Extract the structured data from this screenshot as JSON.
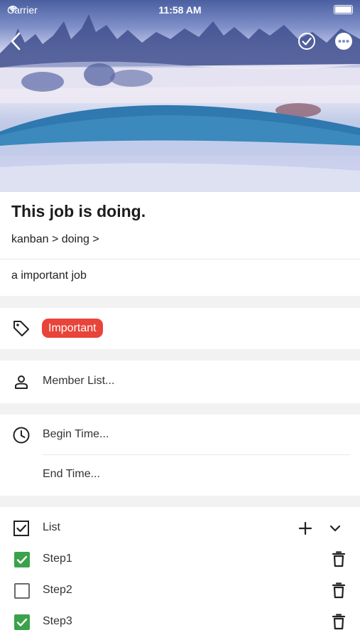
{
  "status_bar": {
    "carrier": "Carrier",
    "time": "11:58 AM"
  },
  "header": {
    "back_icon": "chevron-left-icon",
    "done_icon": "check-circle-icon",
    "more_icon": "more-circle-icon"
  },
  "task": {
    "title": "This job is doing.",
    "breadcrumb": "kanban > doing >",
    "description": "a important job"
  },
  "tags": {
    "items": [
      {
        "label": "Important",
        "color": "#e8443a"
      }
    ]
  },
  "members": {
    "placeholder": "Member List..."
  },
  "time": {
    "begin_placeholder": "Begin Time...",
    "end_placeholder": "End Time..."
  },
  "checklist": {
    "label": "List",
    "steps": [
      {
        "label": "Step1",
        "checked": true
      },
      {
        "label": "Step2",
        "checked": false
      },
      {
        "label": "Step3",
        "checked": true
      }
    ]
  },
  "colors": {
    "accent_red": "#e8443a",
    "check_green": "#3aa24a"
  }
}
